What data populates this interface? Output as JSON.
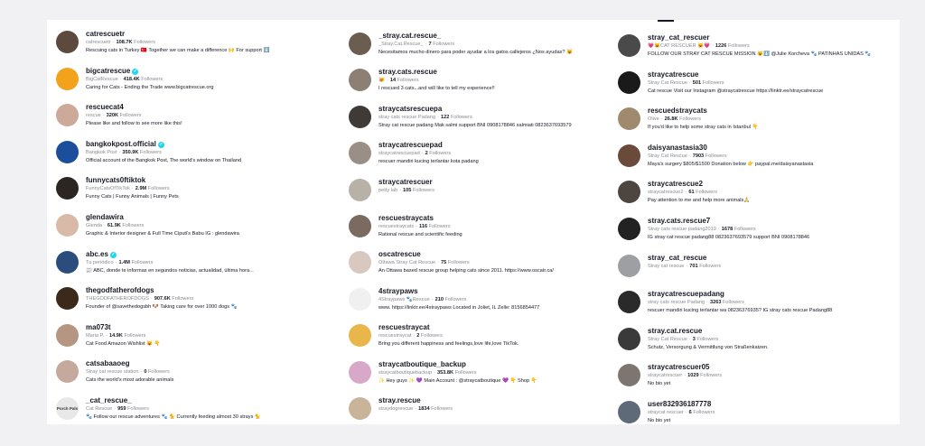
{
  "columns": [
    [
      {
        "username": "catrescuetr",
        "display": "catrescuetr",
        "followers": "108.7K",
        "bio": "Rescuing cats in Turkey 🇹🇷 Together we can make a difference 🙌 For support ⬇️",
        "avatar_color": "#5b4a3d"
      },
      {
        "username": "bigcatrescue",
        "verified": true,
        "display": "BigCatRescue",
        "followers": "418.4K",
        "bio": "Caring for Cats - Ending the Trade www.bigcatrescue.org",
        "avatar_color": "#f3a21c"
      },
      {
        "username": "rescuecat4",
        "display": "rescue",
        "followers": "320K",
        "bio": "Please like and follow to see more like this!",
        "avatar_color": "#cda99a"
      },
      {
        "username": "bangkokpost.official",
        "verified": true,
        "display": "Bangkok Post",
        "followers": "350.9K",
        "bio": "Official account of the Bangkok Post, The world's window on Thailand",
        "avatar_color": "#1b4f9c"
      },
      {
        "username": "funnycats0ftiktok",
        "display": "FunnyCatsOfTikTok",
        "followers": "2.9M",
        "bio": "Funny Cats | Funny Animals | Funny Pets",
        "avatar_color": "#2b2622"
      },
      {
        "username": "glendawira",
        "display": "Glenda",
        "followers": "61.9K",
        "bio": "Graphic & Interior designer & Full Time Ciputi's Babu IG : glendawira",
        "avatar_color": "#d9b9a8"
      },
      {
        "username": "abc.es",
        "verified": true,
        "display": "Tu periódico",
        "followers": "1.4M",
        "bio": "📰 ABC, donde te informas en segundos noticias, actualidad, última hora...",
        "avatar_color": "#2a4d7e"
      },
      {
        "username": "thegodfatherofdogs",
        "display": "THEGODFATHEROFDOGS",
        "followers": "907.6K",
        "bio": "Founder of @savethedogsbh 🐶 Taking care for over 1000 dogs 🐾",
        "avatar_color": "#3b2a1c"
      },
      {
        "username": "ma073t",
        "display": "Maria P.",
        "followers": "14.9K",
        "bio": "Cat Food Amazon Wishlist 😺 👇",
        "avatar_color": "#b59682"
      },
      {
        "username": "catsabaaoeg",
        "display": "Stray cat rescue station",
        "followers": "0",
        "bio": "Cats the world's most adorable animals",
        "avatar_color": "#c6a99d"
      },
      {
        "username": "_cat_rescue_",
        "display": "Cat Rescue",
        "followers": "959",
        "bio": "🐾 Follow our rescue adventures 🐾 🐈 Currently feeding almost 30 strays 🐈",
        "avatar_color": "#e8e8e8",
        "avatar_text": "Porch Pals"
      }
    ],
    [
      {
        "username": "_stray.cat.rescue_",
        "display": "_Stray.Cat.Rescue_",
        "followers": "7",
        "bio": "Necesitamos mucho dinero para poder ayudar a los gatos callejeros ¿Nos ayudas? 😺",
        "avatar_color": "#6b5d50"
      },
      {
        "username": "stray.cats.rescue",
        "display": "😿",
        "followers": "14",
        "bio": "I rescued 3 cats...and will like to tell my experience!!",
        "avatar_color": "#8c7f74"
      },
      {
        "username": "straycatsrescuepa",
        "display": "stray cats rescue Padang",
        "followers": "122",
        "bio": "Stray cat rescue padang Mak salmi support BNI 0908178846 salmiati 0823637693579",
        "avatar_color": "#3f3a36"
      },
      {
        "username": "straycatrescuepad",
        "display": "straycatrescuepad",
        "followers": "2",
        "bio": "rescuer mandiri kucing terlantar kota padang",
        "avatar_color": "#9a8f86"
      },
      {
        "username": "straycatrescuer",
        "display": "petty lab",
        "followers": "105",
        "bio": "",
        "avatar_color": "#b8b1a8"
      },
      {
        "username": "rescuestraycats",
        "display": "rescuestraycats",
        "followers": "116",
        "bio": "Rational rescue and scientific feeding",
        "avatar_color": "#7a6a5f"
      },
      {
        "username": "oscatrescue",
        "display": "Ottawa Stray Cat Rescue",
        "followers": "75",
        "bio": "An Ottawa based rescue group helping cats since 2011. https://www.oscatr.ca/",
        "avatar_color": "#d9c8c0"
      },
      {
        "username": "4straypaws",
        "display": "4Straypaws 🐾Rescue",
        "followers": "210",
        "bio": "www. https://linktr.ee/4straypaws Located in Joliet, IL Zelle: 8156854477",
        "avatar_color": "#f0f0f0"
      },
      {
        "username": "rescuestraycat",
        "display": "rescuestraycat",
        "followers": "2",
        "bio": "Bring you different happiness and feelings,love life,love TikTok.",
        "avatar_color": "#e8b64a"
      },
      {
        "username": "straycatboutique_backup",
        "display": "straycatboutiquebackup",
        "followers": "353.8K",
        "bio": "✨ Hey guys ✨ 💜 Main Account : @straycatboutique 💜 👇 Shop 👇",
        "avatar_color": "#d8a8c8"
      },
      {
        "username": "stray.rescue",
        "display": "straydogrescue",
        "followers": "1834",
        "bio": "",
        "avatar_color": "#c9b49a"
      }
    ],
    [
      {
        "username": "stray_cat_rescuer",
        "display": "💗😺CAT RESCUER 😺💗",
        "followers": "1226",
        "bio": "FOLLOW OUR STRAY CAT RESCUE MISSION 😺⬇️ @Julie Korcheva 🐾 PATINHAS UNIDAS 🐾",
        "avatar_color": "#4a4a4a"
      },
      {
        "username": "straycatrescue",
        "display": "Stray Cat Rescue",
        "followers": "501",
        "bio": "Cat rescue Visit our Instagram @straycatrescue https://linktr.ee/straycatrescue",
        "avatar_color": "#1a1a1a"
      },
      {
        "username": "rescuedstraycats",
        "display": "Olive",
        "followers": "26.8K",
        "bio": "If you'd like to help some stray cats in Istanbul 👇",
        "avatar_color": "#a08a6e"
      },
      {
        "username": "daisyanastasia30",
        "display": "Stray Cat Rescue",
        "followers": "7903",
        "bio": "Maya's surgery $805/$1500 Donation below 👉 paypal.me/daisyanastasia",
        "avatar_color": "#6a4a3a"
      },
      {
        "username": "straycatrescue2",
        "display": "straycatrescue2",
        "followers": "61",
        "bio": "Pay attention to me and help more animals🙏",
        "avatar_color": "#4d4640"
      },
      {
        "username": "stray.cats.rescue7",
        "display": "Stray cats rescue padang2019",
        "followers": "1678",
        "bio": "IG stray cat rescue padang88 0823637693579 support BNI 0908178846",
        "avatar_color": "#222222"
      },
      {
        "username": "stray_cat_rescue",
        "display": "Stray cat rescue",
        "followers": "701",
        "bio": "",
        "avatar_color": "#9d9fa2"
      },
      {
        "username": "straycatrescuepadang",
        "display": "stray cats rescue Padang",
        "followers": "3263",
        "bio": "rescuer mandiri kucing terlantar wa 08236376935? IG stray cats rescue Padang88",
        "avatar_color": "#2a2a2a"
      },
      {
        "username": "stray.cat.rescue",
        "display": "Stray Cat Rescue",
        "followers": "3",
        "bio": "Schutz, Versorgung & Vermittlung von Straßenkatzen.",
        "avatar_color": "#3a3a3a"
      },
      {
        "username": "straycatrescuer05",
        "display": "straycatrescuer",
        "followers": "1029",
        "bio": "No bio yet",
        "avatar_color": "#7d7670"
      },
      {
        "username": "user832936187778",
        "display": "straycat rescuer",
        "followers": "6",
        "bio": "No bio yet",
        "avatar_color": "#5f6a78"
      }
    ]
  ],
  "labels": {
    "followers_suffix": "Followers"
  }
}
